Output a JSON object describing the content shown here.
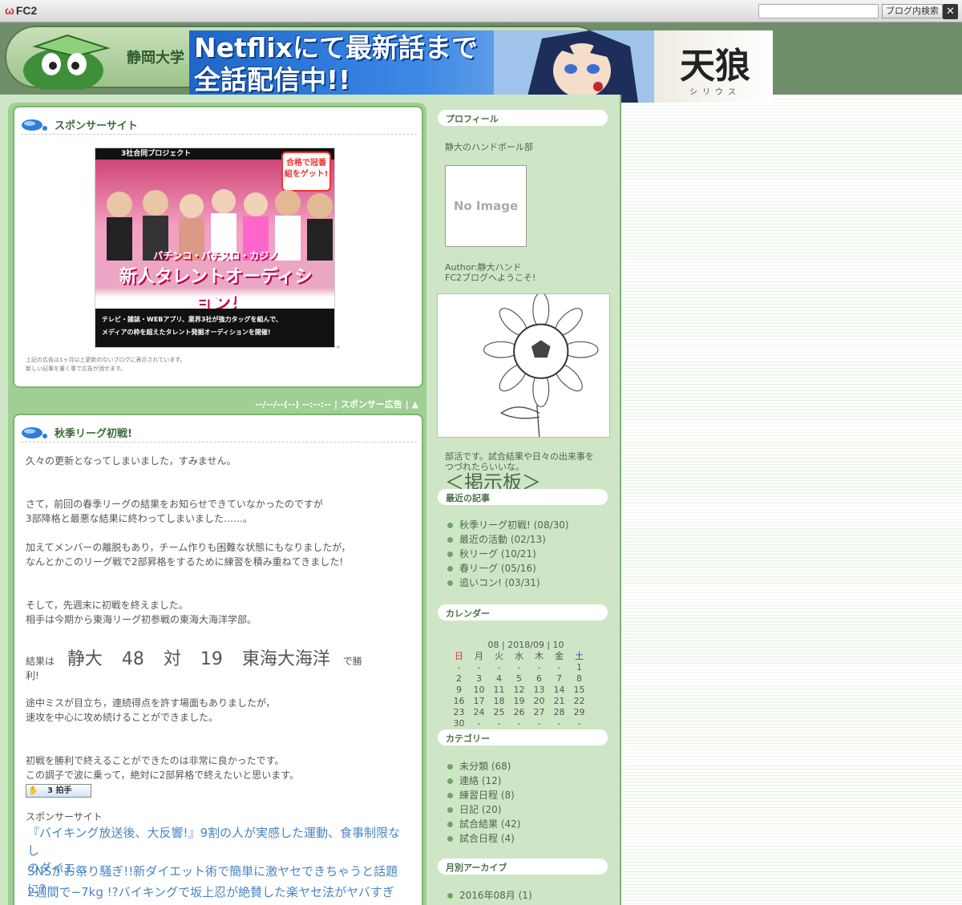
{
  "toolbar": {
    "logo": "FC2",
    "search_button": "ブログ内検索",
    "close": "✕"
  },
  "header": {
    "blog_title": "静岡大学"
  },
  "netflix_ad": {
    "line1": "Netflixにて最新話まで",
    "line2": "全話配信中!!",
    "title": "天狼",
    "subtitle": "シリウス",
    "notice": "上記広告は1ヶ月以上更新のないブログに表示されています。新しい記事を書くことで広告を消せます。"
  },
  "sponsor_entry": {
    "title": "スポンサーサイト",
    "ad": {
      "top": "3社合同プロジェクト",
      "badge": "合格で冠番組をゲット!",
      "banner1": "パチンコ・パチスロ・カジノ",
      "banner2": "新人タレントオーディション!",
      "bottom1": "テレビ・雑誌・WEBアプリ、業界3社が強力タッグを組んで、",
      "bottom2": "メディアの枠を超えたタレント発掘オーディションを開催!"
    },
    "dot": "。",
    "notice1": "上記の広告は1ヶ月以上更新のないブログに表示されています。",
    "notice2": "新しい記事を書く事で広告が消せます。",
    "footer": "--/--/--(--) --:--:-- | スポンサー広告 | ▲"
  },
  "post": {
    "title": "秋季リーグ初戦!",
    "p1": "久々の更新となってしまいました，すみません。",
    "p2a": "さて，前回の春季リーグの結果をお知らせできていなかったのですが",
    "p2b": "3部降格と最悪な結果に終わってしまいました……。",
    "p3a": "加えてメンバーの離脱もあり，チーム作りも困難な状態にもなりましたが，",
    "p3b": "なんとかこのリーグ戦で2部昇格をするために練習を積み重ねてきました!",
    "p4a": "そして，先週末に初戦を終えました。",
    "p4b": "相手は今期から東海リーグ初参戦の東海大海洋学部。",
    "result_prefix": "結果は",
    "team1": "静大",
    "score1": "48",
    "versus": "対",
    "score2": "19",
    "team2": "東海大海洋",
    "result_suffix": "で勝",
    "result_suffix2": "利!",
    "p5a": "途中ミスが目立ち，連続得点を許す場面もありましたが，",
    "p5b": "速攻を中心に攻め続けることができました。",
    "p6a": "初戦を勝利で終えることができたのは非常に良かったです。",
    "p6b": "この調子で波に乗って，絶対に2部昇格で終えたいと思います。",
    "clap": "3 拍手",
    "sponsor_label": "スポンサーサイト",
    "link1a": "『バイキング放送後、大反響!』9割の人が実感した運動、食事制限なし",
    "link1b": "のダイエ...",
    "link2": "SNSがお祭り騒ぎ!!新ダイエット術で簡単に激ヤセできちゃうと話題に?",
    "link3": "2週間で−7kg !?バイキングで坂上忍が絶賛した楽ヤセ法がヤバすぎ"
  },
  "sidebar": {
    "profile_head": "プロフィール",
    "profile_name": "静大のハンドボール部",
    "no_image": "No Image",
    "author": "Author:静大ハンド",
    "welcome": "FC2ブログへようこそ!",
    "desc1": "部活です。試合結果や日々の出来事を",
    "desc2": "つづれたらいいな。",
    "bbs": "＜掲示板＞",
    "recent_head": "最近の記事",
    "recent": [
      "秋季リーグ初戦! (08/30)",
      "最近の活動 (02/13)",
      "秋リーグ (10/21)",
      "春リーグ (05/16)",
      "追いコン! (03/31)"
    ],
    "calendar_head": "カレンダー",
    "calendar_nav": "08 | 2018/09 | 10",
    "weekdays": [
      "日",
      "月",
      "火",
      "水",
      "木",
      "金",
      "土"
    ],
    "weeks": [
      [
        "-",
        "-",
        "-",
        "-",
        "-",
        "-",
        "1"
      ],
      [
        "2",
        "3",
        "4",
        "5",
        "6",
        "7",
        "8"
      ],
      [
        "9",
        "10",
        "11",
        "12",
        "13",
        "14",
        "15"
      ],
      [
        "16",
        "17",
        "18",
        "19",
        "20",
        "21",
        "22"
      ],
      [
        "23",
        "24",
        "25",
        "26",
        "27",
        "28",
        "29"
      ],
      [
        "30",
        "-",
        "-",
        "-",
        "-",
        "-",
        "-"
      ]
    ],
    "category_head": "カテゴリー",
    "categories": [
      "未分類 (68)",
      "連絡 (12)",
      "練習日程 (8)",
      "日記 (20)",
      "試合結果 (42)",
      "試合日程 (4)"
    ],
    "archive_head": "月別アーカイブ",
    "archives": [
      "2016年08月 (1)"
    ]
  }
}
